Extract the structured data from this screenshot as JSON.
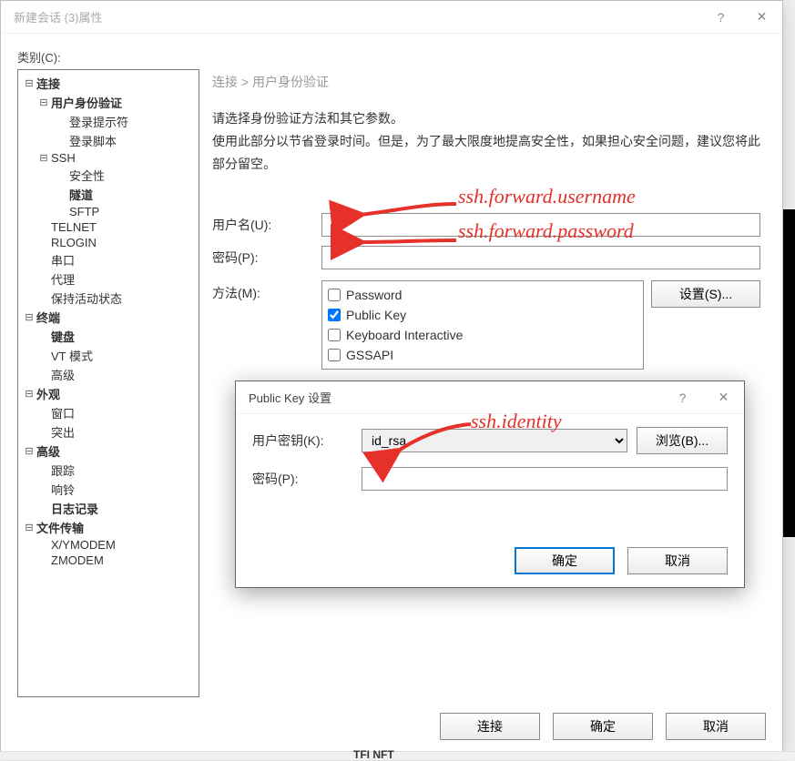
{
  "window": {
    "title": "新建会话 (3)属性",
    "help_glyph": "?",
    "close_glyph": "✕",
    "category_label": "类别(C):"
  },
  "tree": {
    "nodes": [
      {
        "label": "连接",
        "level": 1,
        "bold": true,
        "expandable": true
      },
      {
        "label": "用户身份验证",
        "level": 2,
        "bold": true,
        "expandable": true
      },
      {
        "label": "登录提示符",
        "level": 3
      },
      {
        "label": "登录脚本",
        "level": 3
      },
      {
        "label": "SSH",
        "level": 2,
        "expandable": true
      },
      {
        "label": "安全性",
        "level": 3
      },
      {
        "label": "隧道",
        "level": 3,
        "bold": true
      },
      {
        "label": "SFTP",
        "level": 3
      },
      {
        "label": "TELNET",
        "level": 2
      },
      {
        "label": "RLOGIN",
        "level": 2
      },
      {
        "label": "串口",
        "level": 2
      },
      {
        "label": "代理",
        "level": 2
      },
      {
        "label": "保持活动状态",
        "level": 2
      },
      {
        "label": "终端",
        "level": 1,
        "bold": true,
        "expandable": true
      },
      {
        "label": "键盘",
        "level": 2,
        "bold": true
      },
      {
        "label": "VT 模式",
        "level": 2
      },
      {
        "label": "高级",
        "level": 2
      },
      {
        "label": "外观",
        "level": 1,
        "bold": true,
        "expandable": true
      },
      {
        "label": "窗口",
        "level": 2
      },
      {
        "label": "突出",
        "level": 2
      },
      {
        "label": "高级",
        "level": 1,
        "bold": true,
        "expandable": true
      },
      {
        "label": "跟踪",
        "level": 2
      },
      {
        "label": "响铃",
        "level": 2
      },
      {
        "label": "日志记录",
        "level": 2,
        "bold": true
      },
      {
        "label": "文件传输",
        "level": 1,
        "bold": true,
        "expandable": true
      },
      {
        "label": "X/YMODEM",
        "level": 2
      },
      {
        "label": "ZMODEM",
        "level": 2
      }
    ]
  },
  "panel": {
    "breadcrumb": "连接 > 用户身份验证",
    "desc_line1": "请选择身份验证方法和其它参数。",
    "desc_line2": "使用此部分以节省登录时间。但是，为了最大限度地提高安全性，如果担心安全问题，建议您将此部分留空。",
    "username_label": "用户名(U):",
    "username_value": "",
    "password_label": "密码(P):",
    "password_value": "",
    "method_label": "方法(M):",
    "methods": [
      {
        "name": "Password",
        "checked": false
      },
      {
        "name": "Public Key",
        "checked": true
      },
      {
        "name": "Keyboard Interactive",
        "checked": false
      },
      {
        "name": "GSSAPI",
        "checked": false
      }
    ],
    "settings_btn": "设置(S)..."
  },
  "footer": {
    "connect": "连接",
    "ok": "确定",
    "cancel": "取消"
  },
  "annotations": {
    "username_note": "ssh.forward.username",
    "password_note": "ssh.forward.password",
    "identity_note": "ssh.identity"
  },
  "subdialog": {
    "title": "Public Key 设置",
    "help_glyph": "?",
    "close_glyph": "✕",
    "userkey_label": "用户密钥(K):",
    "userkey_value": "id_rsa",
    "browse_btn": "浏览(B)...",
    "passphrase_label": "密码(P):",
    "passphrase_value": "",
    "ok": "确定",
    "cancel": "取消"
  },
  "misc": {
    "tiny_telnet": "TFI NFT"
  }
}
